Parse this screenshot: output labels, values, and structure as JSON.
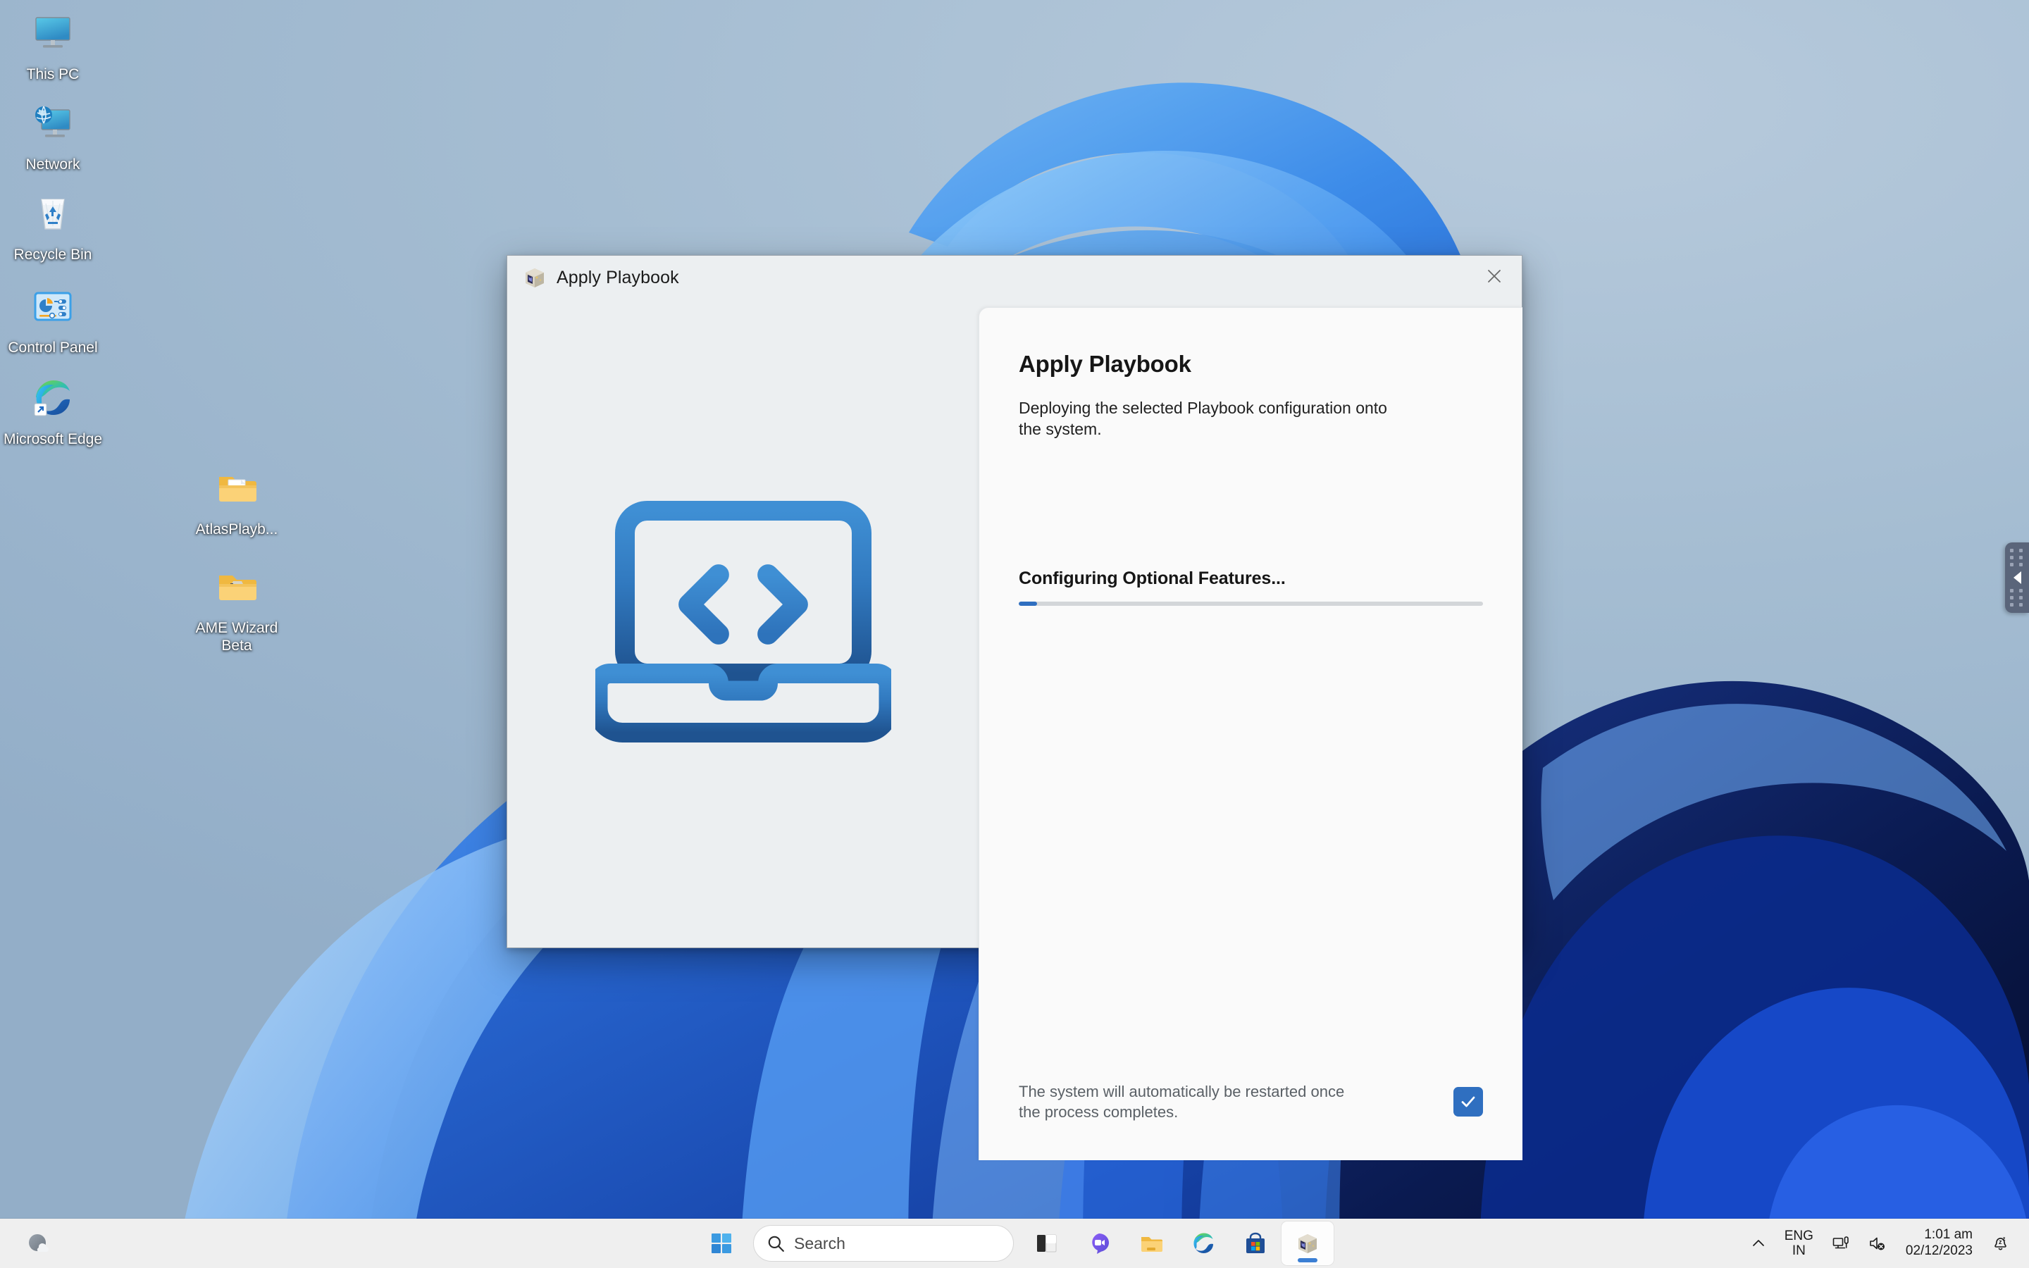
{
  "desktop": {
    "icons_column_1": [
      {
        "label": "This PC",
        "icon": "this-pc-icon"
      },
      {
        "label": "Network",
        "icon": "network-icon"
      },
      {
        "label": "Recycle Bin",
        "icon": "recycle-bin-icon"
      },
      {
        "label": "Control Panel",
        "icon": "control-panel-icon"
      },
      {
        "label": "Microsoft Edge",
        "icon": "microsoft-edge-icon"
      }
    ],
    "icons_column_2": [
      {
        "label": "AtlasPlayb...",
        "icon": "folder-icon"
      },
      {
        "label": "AME Wizard Beta",
        "icon": "folder-icon"
      }
    ]
  },
  "dialog": {
    "titlebar": {
      "title": "Apply Playbook",
      "app_icon": "ame-wizard-cube-icon",
      "close_icon": "close-icon"
    },
    "illustration_icon": "laptop-code-icon",
    "card": {
      "heading": "Apply Playbook",
      "subtitle": "Deploying the selected Playbook configuration onto the system.",
      "progress": {
        "label": "Configuring Optional Features...",
        "percent": 4,
        "fill_color": "#2f6fc0",
        "track_color": "#d3d6d9"
      },
      "footer": {
        "restart_note": "The system will automatically be restarted once the process completes.",
        "checkbox_checked": true,
        "checkbox_color": "#2f6fc0",
        "checkbox_icon": "check-icon"
      }
    }
  },
  "side_panel_handle": {
    "icon": "chevron-left-icon"
  },
  "taskbar": {
    "weather_icon": "weather-cloud-icon",
    "start_icon": "start-windows-icon",
    "search": {
      "placeholder": "Search",
      "icon": "search-icon"
    },
    "pinned": [
      {
        "name": "task-view",
        "icon": "task-view-icon"
      },
      {
        "name": "chat",
        "icon": "chat-teams-icon"
      },
      {
        "name": "file-explorer",
        "icon": "file-explorer-icon"
      },
      {
        "name": "microsoft-edge",
        "icon": "microsoft-edge-icon"
      },
      {
        "name": "microsoft-store",
        "icon": "microsoft-store-icon"
      },
      {
        "name": "ame-wizard",
        "icon": "ame-wizard-cube-icon",
        "active": true
      }
    ],
    "tray": {
      "overflow_icon": "chevron-up-icon",
      "language_line1": "ENG",
      "language_line2": "IN",
      "network_icon": "network-tray-icon",
      "volume_icon": "volume-muted-icon",
      "time": "1:01 am",
      "date": "02/12/2023",
      "notification_icon": "notifications-silenced-icon"
    }
  },
  "colors": {
    "accent": "#2f6fc0",
    "dialog_bg": "#eceff1",
    "card_bg": "#fafafa",
    "taskbar_bg": "#efefef",
    "desktop_sky": "#93aec8"
  }
}
